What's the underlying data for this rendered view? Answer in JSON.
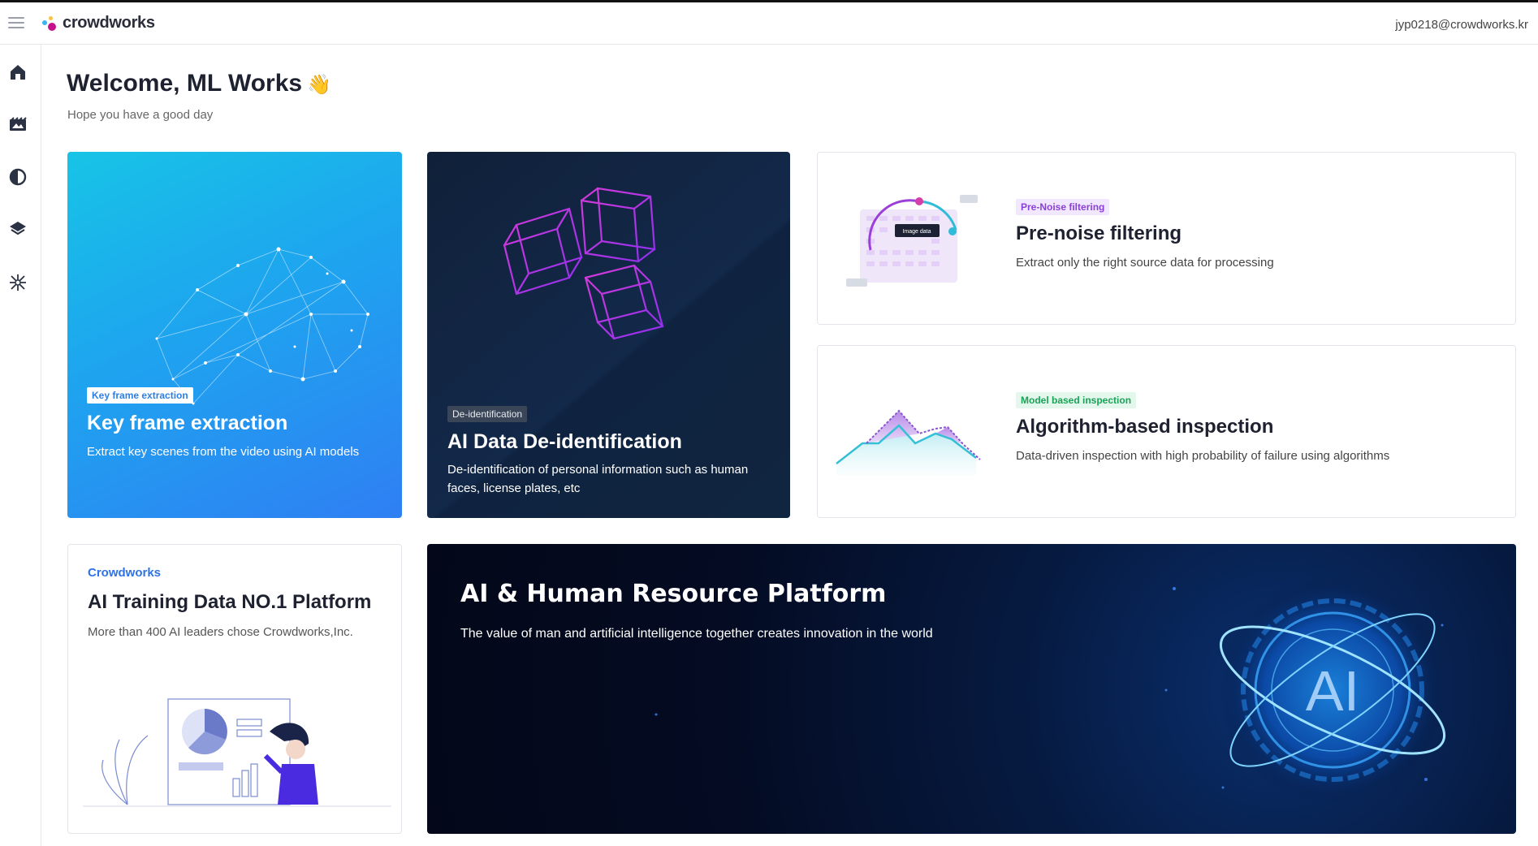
{
  "header": {
    "logo_text": "crowdworks",
    "user_email": "jyp0218@crowdworks.kr"
  },
  "sidebar": {
    "items": [
      {
        "icon": "home-icon"
      },
      {
        "icon": "video-icon"
      },
      {
        "icon": "contrast-icon"
      },
      {
        "icon": "layers-icon"
      },
      {
        "icon": "sparkle-icon"
      }
    ]
  },
  "main": {
    "welcome_title": "Welcome, ML Works",
    "welcome_emoji": "👋",
    "subtitle": "Hope you have a good day"
  },
  "cards": {
    "key_frame": {
      "tag": "Key frame extraction",
      "title": "Key frame extraction",
      "desc": "Extract key scenes from the video using AI models"
    },
    "deid": {
      "tag": "De-identification",
      "title": "AI Data De-identification",
      "desc": "De-identification of personal information such as human faces, license plates, etc"
    },
    "pre_noise": {
      "tag": "Pre-Noise filtering",
      "title": "Pre-noise filtering",
      "desc": "Extract only the right source data for processing",
      "illustration_label": "Image data"
    },
    "algo": {
      "tag": "Model based inspection",
      "title": "Algorithm-based inspection",
      "desc": "Data-driven inspection with high probability of failure using algorithms"
    },
    "crowdworks": {
      "brand": "Crowdworks",
      "title": "AI Training Data NO.1 Platform",
      "desc": "More than 400 AI leaders chose Crowdworks,Inc."
    },
    "banner": {
      "title": "AI & Human Resource Platform",
      "desc": "The value of man and artificial intelligence together creates innovation in the world",
      "emblem_text": "AI"
    }
  },
  "colors": {
    "accent_blue": "#2f72e5",
    "deid_bg": "#13294a",
    "banner_bg": "#040b22",
    "tag_purple": "#8a3fd6",
    "tag_green": "#1aa258"
  }
}
